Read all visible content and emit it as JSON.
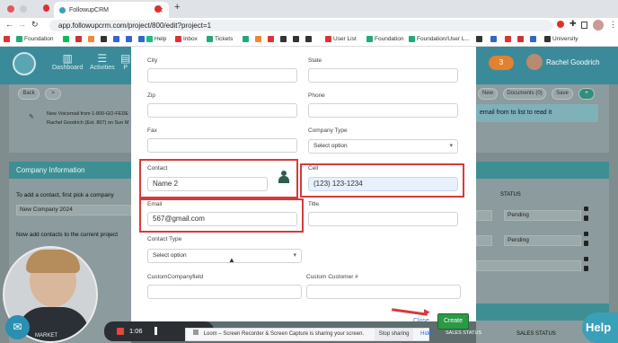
{
  "browser": {
    "tab_title": "FollowupCRM",
    "url": "app.followupcrm.com/project/800/edit?project=1",
    "new_tab_symbol": "+",
    "bookmarks": [
      "Foundation",
      "Help",
      "Inbox",
      "Tickets",
      "User List",
      "Foundation",
      "Foundation/User L...",
      "University"
    ]
  },
  "app": {
    "nav": [
      "Dashboard",
      "Activities",
      "P"
    ],
    "notification_count": "3",
    "user_name": "Rachel Goodrich"
  },
  "background": {
    "back_button": "Back",
    "next_symbol": ">",
    "voicemail_line1": "New Voicemail from 1-800-GO-FEDE",
    "voicemail_line2": "Rachel Goodrich (Ext. 807) on Sun M",
    "buttons": {
      "new": "New",
      "documents": "Documents (0)",
      "save": "Save",
      "add": "+"
    },
    "email_hint": "email from to list to read it",
    "company_info_title": "Company Information",
    "add_contact_hint": "To add a contact, first pick a company",
    "company_value": "New Company 2024",
    "add_contacts_hint": "Now add contacts to the current project",
    "status_header": "STATUS",
    "status_values": [
      "Pending",
      "Pending"
    ],
    "footer_left": "MARKET",
    "footer_right": "SALES STATUS"
  },
  "modal": {
    "fields": {
      "city_label": "City",
      "state_label": "State",
      "zip_label": "Zip",
      "phone_label": "Phone",
      "fax_label": "Fax",
      "company_type_label": "Company Type",
      "company_type_value": "Select option",
      "contact_label": "Contact",
      "contact_value": "Name 2",
      "cell_label": "Cell",
      "cell_value": "(123) 123-1234",
      "email_label": "Email",
      "email_value": "567@gmail.com",
      "title_label": "Title",
      "contact_type_label": "Contact Type",
      "contact_type_value": "Select option",
      "custom_company_label": "CustomCompanyfield",
      "custom_customer_label": "Custom Customer #"
    },
    "close_label": "Close",
    "create_label": "Create"
  },
  "overlays": {
    "help_label": "Help",
    "recorder_time": "1:06",
    "loom_message": "Loom – Screen Recorder & Screen Capture is sharing your screen.",
    "stop_sharing": "Stop sharing",
    "hide": "Hide"
  },
  "colors": {
    "app_teal": "#3b8a99",
    "annotation_red": "#d63b3b",
    "create_green": "#2a9a45",
    "cell_highlight": "#e8f0fc"
  }
}
